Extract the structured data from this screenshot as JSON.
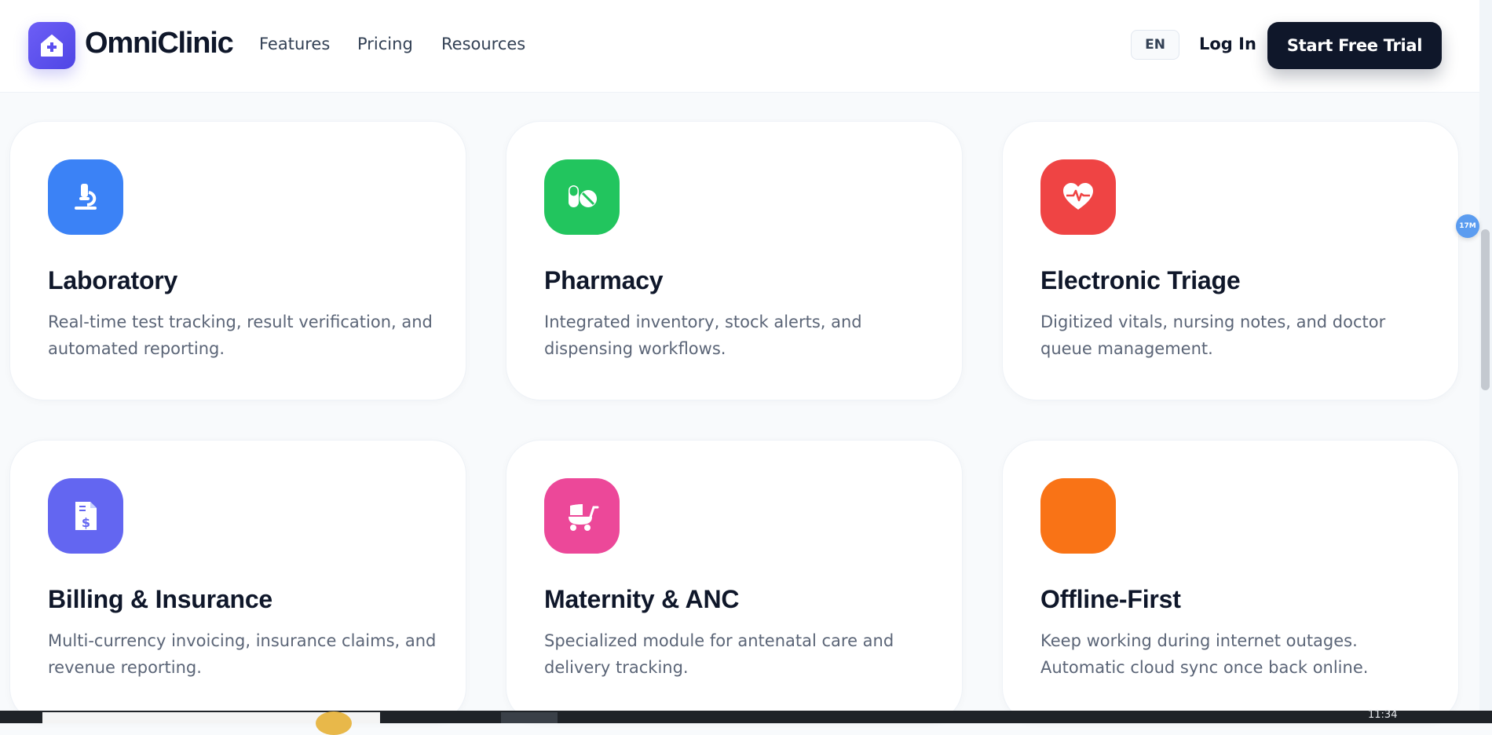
{
  "header": {
    "brand": "OmniClinic",
    "nav": [
      "Features",
      "Pricing",
      "Resources"
    ],
    "language": "EN",
    "login": "Log In",
    "cta": "Start Free Trial"
  },
  "features": [
    {
      "title": "Laboratory",
      "description": "Real-time test tracking, result verification, and automated reporting.",
      "color": "#3b82f6",
      "icon": "microscope-icon"
    },
    {
      "title": "Pharmacy",
      "description": "Integrated inventory, stock alerts, and dispensing workflows.",
      "color": "#22c55e",
      "icon": "pills-icon"
    },
    {
      "title": "Electronic Triage",
      "description": "Digitized vitals, nursing notes, and doctor queue management.",
      "color": "#ef4444",
      "icon": "heart-pulse-icon"
    },
    {
      "title": "Billing & Insurance",
      "description": "Multi-currency invoicing, insurance claims, and revenue reporting.",
      "color": "#6366f1",
      "icon": "invoice-dollar-icon"
    },
    {
      "title": "Maternity & ANC",
      "description": "Specialized module for antenatal care and delivery tracking.",
      "color": "#ec4899",
      "icon": "baby-carriage-icon"
    },
    {
      "title": "Offline-First",
      "description": "Keep working during internet outages. Automatic cloud sync once back online.",
      "color": "#f97316",
      "icon": "offline-sync-icon"
    }
  ],
  "overlay": {
    "badge": "17M"
  },
  "taskbar": {
    "time": "11:34"
  }
}
